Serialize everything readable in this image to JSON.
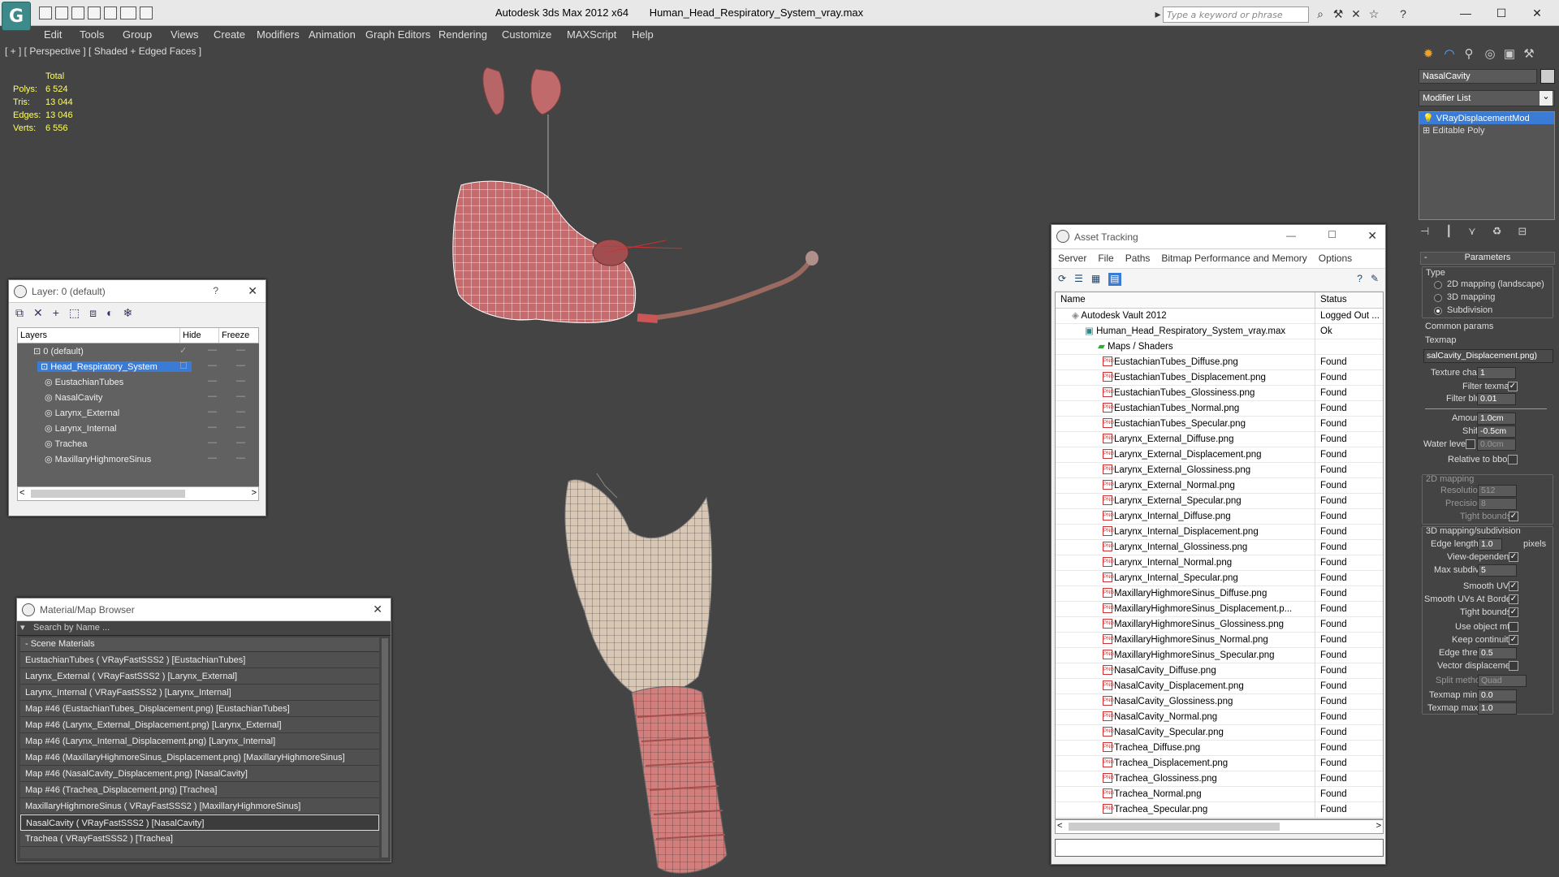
{
  "titlebar": {
    "app_title": "Autodesk 3ds Max  2012 x64",
    "file_name": "Human_Head_Respiratory_System_vray.max",
    "search_placeholder": "Type a keyword or phrase"
  },
  "menus": [
    "Edit",
    "Tools",
    "Group",
    "Views",
    "Create",
    "Modifiers",
    "Animation",
    "Graph Editors",
    "Rendering",
    "Customize",
    "MAXScript",
    "Help"
  ],
  "viewport": {
    "label": "[ + ] [ Perspective ] [ Shaded + Edged Faces ]",
    "stats": {
      "header": "Total",
      "rows": [
        {
          "k": "Polys:",
          "v": "6 524"
        },
        {
          "k": "Tris:",
          "v": "13 044"
        },
        {
          "k": "Edges:",
          "v": "13 046"
        },
        {
          "k": "Verts:",
          "v": "6 556"
        }
      ]
    }
  },
  "layer_panel": {
    "title": "Layer: 0 (default)",
    "help": "?",
    "columns": [
      "Layers",
      "Hide",
      "Freeze"
    ],
    "rows": [
      {
        "name": "0 (default)",
        "indent": 0,
        "checked": true
      },
      {
        "name": "Head_Respiratory_System",
        "indent": 0,
        "selected": true
      },
      {
        "name": "EustachianTubes",
        "indent": 1
      },
      {
        "name": "NasalCavity",
        "indent": 1
      },
      {
        "name": "Larynx_External",
        "indent": 1
      },
      {
        "name": "Larynx_Internal",
        "indent": 1
      },
      {
        "name": "Trachea",
        "indent": 1
      },
      {
        "name": "MaxillaryHighmoreSinus",
        "indent": 1
      }
    ]
  },
  "material_browser": {
    "title": "Material/Map Browser",
    "search_placeholder": "Search by Name ...",
    "group": "- Scene Materials",
    "items": [
      "EustachianTubes  ( VRayFastSSS2 ) [EustachianTubes]",
      "Larynx_External  ( VRayFastSSS2 ) [Larynx_External]",
      "Larynx_Internal  ( VRayFastSSS2 ) [Larynx_Internal]",
      "Map #46 (EustachianTubes_Displacement.png) [EustachianTubes]",
      "Map #46 (Larynx_External_Displacement.png) [Larynx_External]",
      "Map #46 (Larynx_Internal_Displacement.png) [Larynx_Internal]",
      "Map #46 (MaxillaryHighmoreSinus_Displacement.png) [MaxillaryHighmoreSinus]",
      "Map #46 (NasalCavity_Displacement.png) [NasalCavity]",
      "Map #46 (Trachea_Displacement.png) [Trachea]",
      "MaxillaryHighmoreSinus  ( VRayFastSSS2 ) [MaxillaryHighmoreSinus]",
      "NasalCavity  ( VRayFastSSS2 ) [NasalCavity]",
      "Trachea  ( VRayFastSSS2 ) [Trachea]"
    ],
    "selected_index": 10
  },
  "asset_tracking": {
    "title": "Asset Tracking",
    "menu": [
      "Server",
      "File",
      "Paths",
      "Bitmap Performance and Memory",
      "Options"
    ],
    "columns": [
      "Name",
      "Status"
    ],
    "rows": [
      {
        "name": "Autodesk Vault 2012",
        "status": "Logged Out ...",
        "level": 1,
        "icon": "vault"
      },
      {
        "name": "Human_Head_Respiratory_System_vray.max",
        "status": "Ok",
        "level": 2,
        "icon": "max"
      },
      {
        "name": "Maps / Shaders",
        "status": "",
        "level": 3,
        "icon": "maps"
      },
      {
        "name": "EustachianTubes_Diffuse.png",
        "status": "Found",
        "level": 4,
        "icon": "png"
      },
      {
        "name": "EustachianTubes_Displacement.png",
        "status": "Found",
        "level": 4,
        "icon": "png"
      },
      {
        "name": "EustachianTubes_Glossiness.png",
        "status": "Found",
        "level": 4,
        "icon": "png"
      },
      {
        "name": "EustachianTubes_Normal.png",
        "status": "Found",
        "level": 4,
        "icon": "png"
      },
      {
        "name": "EustachianTubes_Specular.png",
        "status": "Found",
        "level": 4,
        "icon": "png"
      },
      {
        "name": "Larynx_External_Diffuse.png",
        "status": "Found",
        "level": 4,
        "icon": "png"
      },
      {
        "name": "Larynx_External_Displacement.png",
        "status": "Found",
        "level": 4,
        "icon": "png"
      },
      {
        "name": "Larynx_External_Glossiness.png",
        "status": "Found",
        "level": 4,
        "icon": "png"
      },
      {
        "name": "Larynx_External_Normal.png",
        "status": "Found",
        "level": 4,
        "icon": "png"
      },
      {
        "name": "Larynx_External_Specular.png",
        "status": "Found",
        "level": 4,
        "icon": "png"
      },
      {
        "name": "Larynx_Internal_Diffuse.png",
        "status": "Found",
        "level": 4,
        "icon": "png"
      },
      {
        "name": "Larynx_Internal_Displacement.png",
        "status": "Found",
        "level": 4,
        "icon": "png"
      },
      {
        "name": "Larynx_Internal_Glossiness.png",
        "status": "Found",
        "level": 4,
        "icon": "png"
      },
      {
        "name": "Larynx_Internal_Normal.png",
        "status": "Found",
        "level": 4,
        "icon": "png"
      },
      {
        "name": "Larynx_Internal_Specular.png",
        "status": "Found",
        "level": 4,
        "icon": "png"
      },
      {
        "name": "MaxillaryHighmoreSinus_Diffuse.png",
        "status": "Found",
        "level": 4,
        "icon": "png"
      },
      {
        "name": "MaxillaryHighmoreSinus_Displacement.p...",
        "status": "Found",
        "level": 4,
        "icon": "png"
      },
      {
        "name": "MaxillaryHighmoreSinus_Glossiness.png",
        "status": "Found",
        "level": 4,
        "icon": "png"
      },
      {
        "name": "MaxillaryHighmoreSinus_Normal.png",
        "status": "Found",
        "level": 4,
        "icon": "png"
      },
      {
        "name": "MaxillaryHighmoreSinus_Specular.png",
        "status": "Found",
        "level": 4,
        "icon": "png"
      },
      {
        "name": "NasalCavity_Diffuse.png",
        "status": "Found",
        "level": 4,
        "icon": "png"
      },
      {
        "name": "NasalCavity_Displacement.png",
        "status": "Found",
        "level": 4,
        "icon": "png"
      },
      {
        "name": "NasalCavity_Glossiness.png",
        "status": "Found",
        "level": 4,
        "icon": "png"
      },
      {
        "name": "NasalCavity_Normal.png",
        "status": "Found",
        "level": 4,
        "icon": "png"
      },
      {
        "name": "NasalCavity_Specular.png",
        "status": "Found",
        "level": 4,
        "icon": "png"
      },
      {
        "name": "Trachea_Diffuse.png",
        "status": "Found",
        "level": 4,
        "icon": "png"
      },
      {
        "name": "Trachea_Displacement.png",
        "status": "Found",
        "level": 4,
        "icon": "png"
      },
      {
        "name": "Trachea_Glossiness.png",
        "status": "Found",
        "level": 4,
        "icon": "png"
      },
      {
        "name": "Trachea_Normal.png",
        "status": "Found",
        "level": 4,
        "icon": "png"
      },
      {
        "name": "Trachea_Specular.png",
        "status": "Found",
        "level": 4,
        "icon": "png"
      }
    ]
  },
  "command_panel": {
    "object_name": "NasalCavity",
    "modifier_list": "Modifier List",
    "stack": [
      "VRayDisplacementMod",
      "Editable Poly"
    ],
    "parameters": {
      "rollout": "Parameters",
      "type_label": "Type",
      "type_options": [
        "2D mapping (landscape)",
        "3D mapping",
        "Subdivision"
      ],
      "type_selected": 2,
      "common_label": "Common params",
      "texmap_label": "Texmap",
      "texmap_value": "salCavity_Displacement.png)",
      "texture_chan_label": "Texture chan",
      "texture_chan": "1",
      "filter_texmap_label": "Filter texmap",
      "filter_texmap": true,
      "filter_blur_label": "Filter blur",
      "filter_blur": "0.01",
      "amount_label": "Amount",
      "amount": "1.0cm",
      "shift_label": "Shift",
      "shift": "-0.5cm",
      "water_label": "Water level",
      "water": "0.0cm",
      "relative_label": "Relative to bbox",
      "map2d_label": "2D mapping",
      "resolution_label": "Resolution",
      "resolution": "512",
      "precision_label": "Precision",
      "precision": "8",
      "tight_label": "Tight bounds",
      "map3d_label": "3D mapping/subdivision",
      "edge_len_label": "Edge length",
      "edge_len": "1.0",
      "pixels_label": "pixels",
      "view_dep_label": "View-dependent",
      "max_subdivs_label": "Max subdivs",
      "max_subdivs": "5",
      "smooth_uvs_label": "Smooth UVs",
      "smooth_borders_label": "Smooth UVs At Borders",
      "tight2_label": "Tight bounds",
      "use_obj_mtl_label": "Use object mtl",
      "keep_cont_label": "Keep continuity",
      "edge_thresh_label": "Edge thresh",
      "edge_thresh": "0.5",
      "vector_disp_label": "Vector displacement",
      "split_label": "Split method:",
      "split_value": "Quad",
      "texmap_min_label": "Texmap min:",
      "texmap_min": "0.0",
      "texmap_max_label": "Texmap max:",
      "texmap_max": "1.0"
    }
  },
  "colors": {
    "viewport_bg": "#444444",
    "stats": "#ffff66",
    "selection": "#3a7bd5",
    "wire": "#ffffff",
    "tissue": "#c0686b"
  }
}
